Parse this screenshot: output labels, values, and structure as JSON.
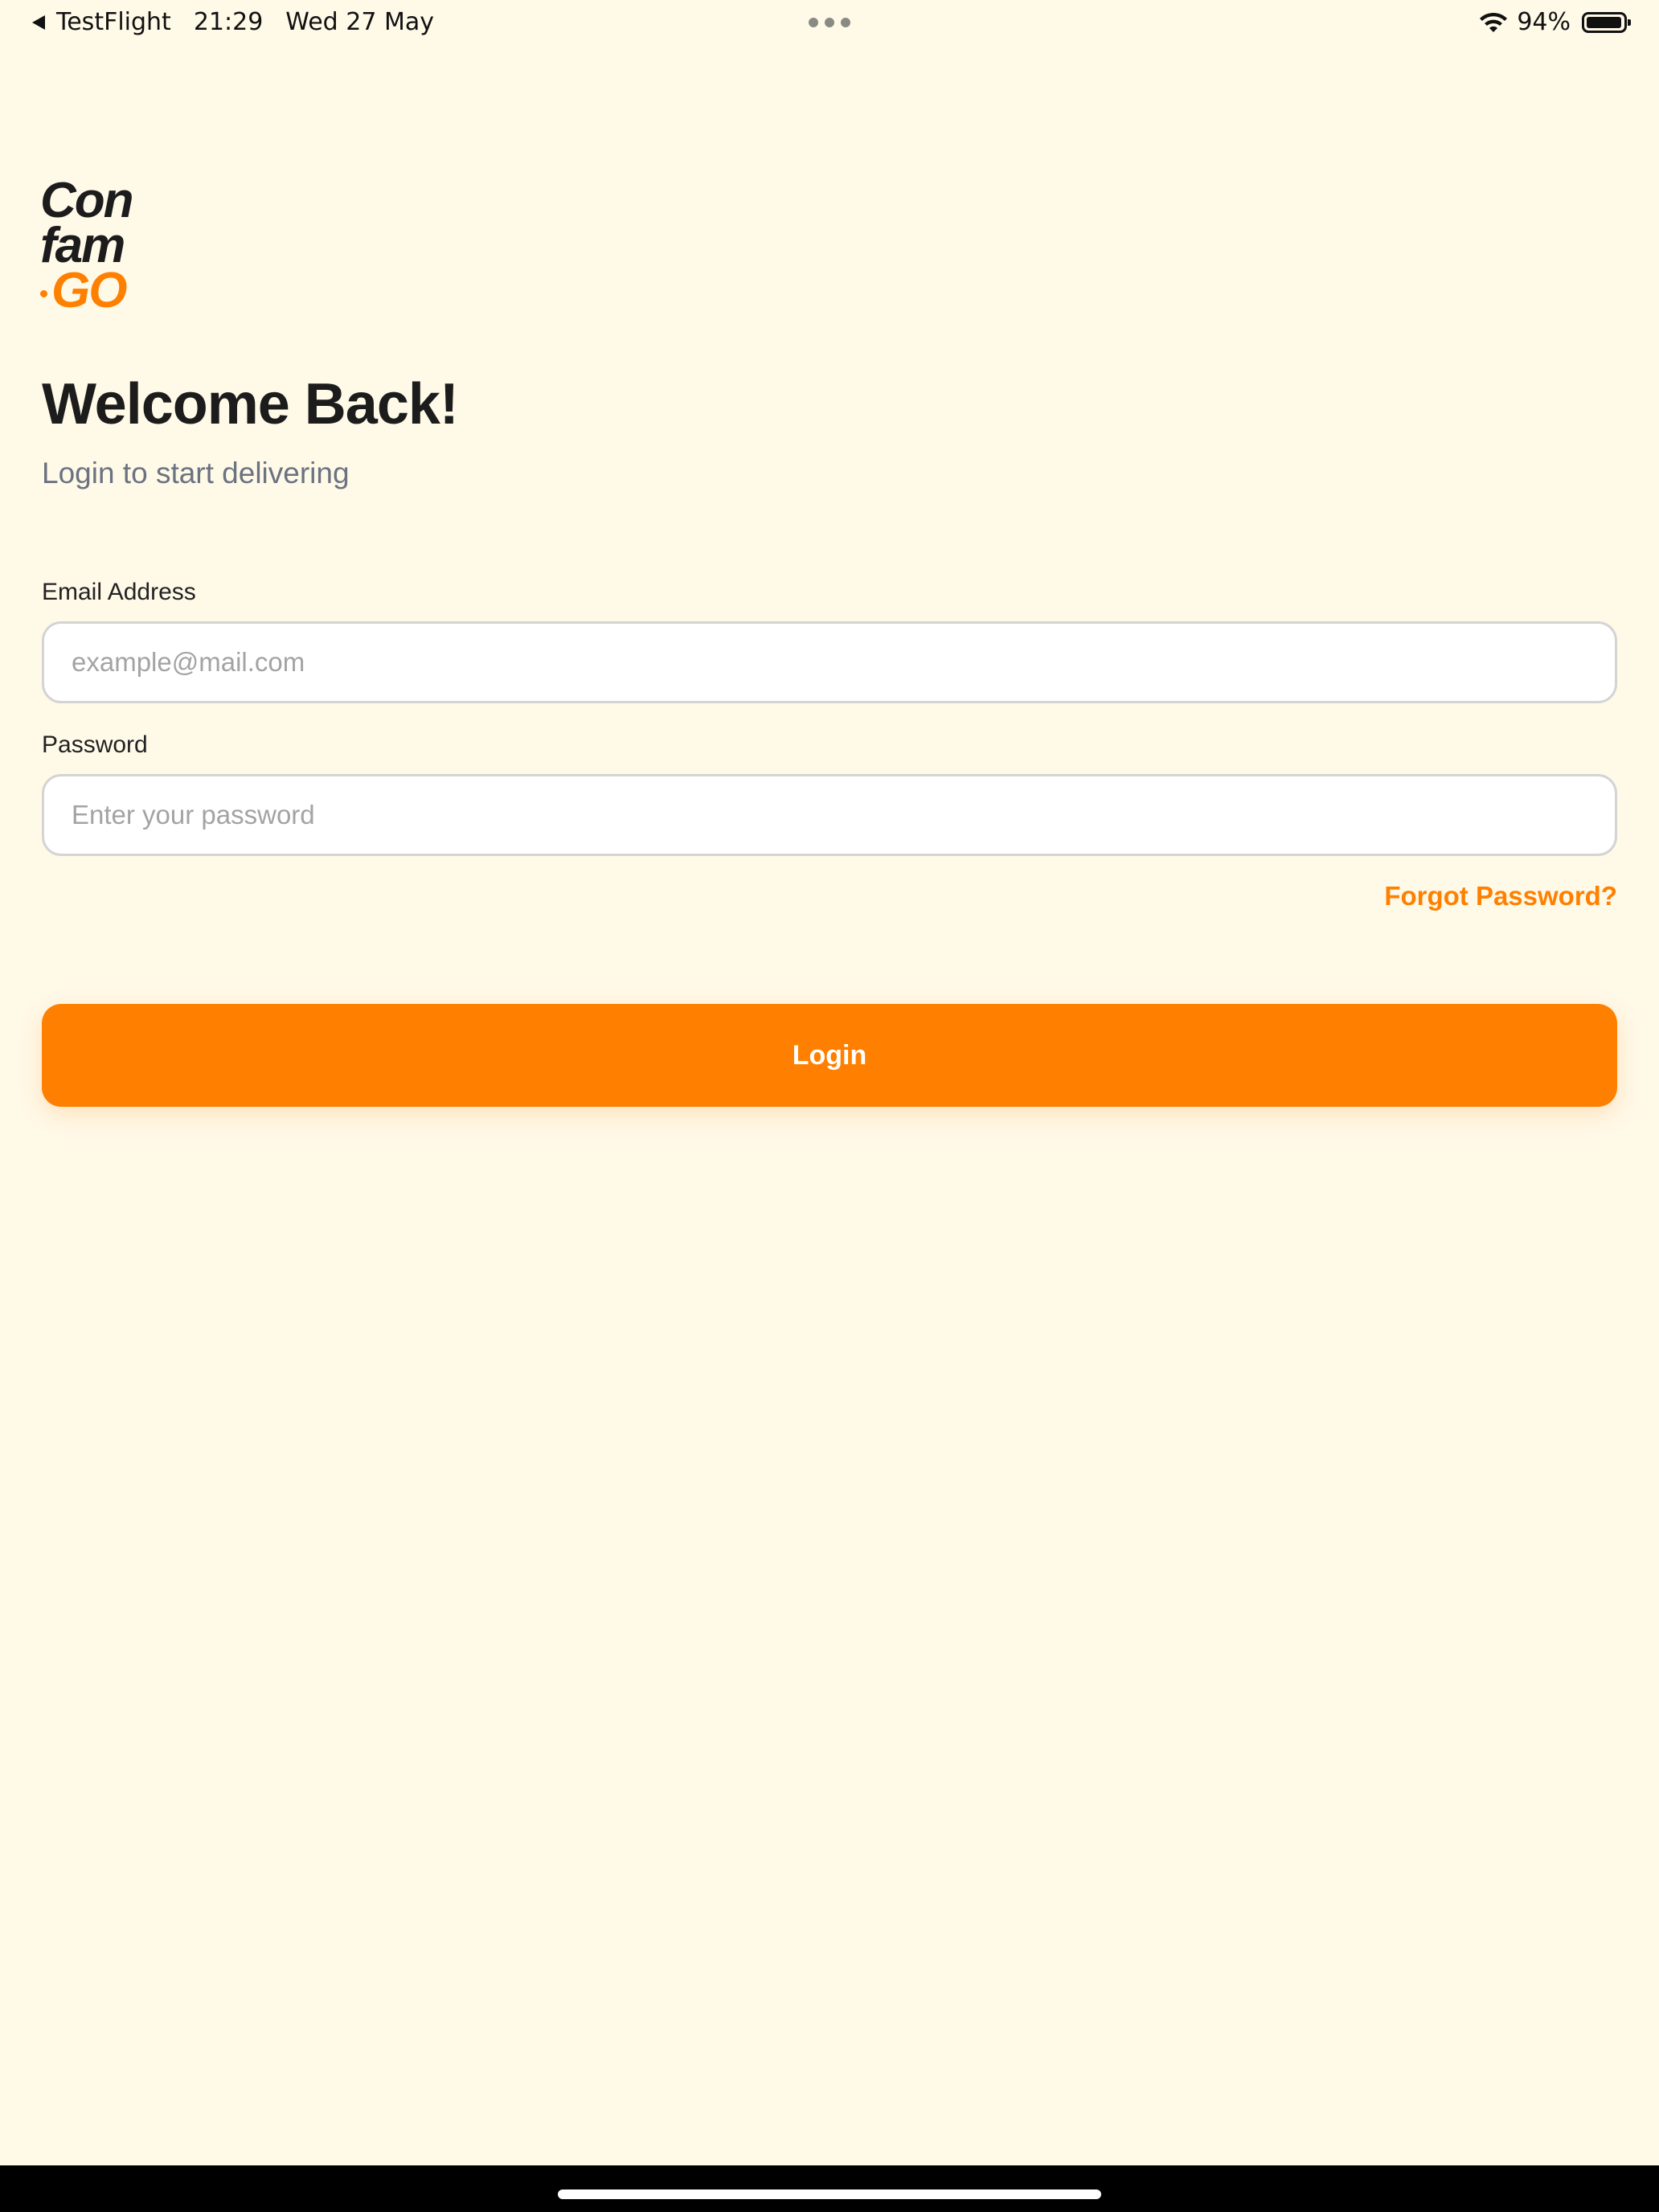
{
  "status_bar": {
    "back_app": "TestFlight",
    "time": "21:29",
    "date": "Wed 27 May",
    "battery": "94%",
    "icons": [
      "back-arrow-icon",
      "more-dots-icon",
      "wifi-icon",
      "battery-icon"
    ]
  },
  "logo": {
    "line1": "Con",
    "line2": "fam",
    "line3": "GO"
  },
  "header": {
    "title": "Welcome Back!",
    "subtitle": "Login to start delivering"
  },
  "form": {
    "email_label": "Email Address",
    "email_value": "",
    "email_placeholder": "example@mail.com",
    "password_label": "Password",
    "password_value": "",
    "password_placeholder": "Enter your password",
    "forgot_label": "Forgot Password?",
    "login_label": "Login"
  },
  "colors": {
    "background": "#FFF9E8",
    "accent": "#FF8000",
    "text": "#1C1C1C",
    "subtle_text": "#6B7280"
  }
}
